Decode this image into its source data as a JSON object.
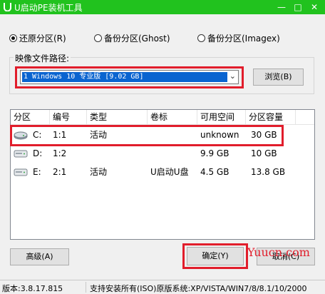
{
  "window": {
    "title": "U启动PE装机工具",
    "controls": {
      "minimize": "—",
      "maximize": "□",
      "close": "✕"
    }
  },
  "modes": [
    {
      "label": "还原分区(R)",
      "selected": true
    },
    {
      "label": "备份分区(Ghost)",
      "selected": false
    },
    {
      "label": "备份分区(Imagex)",
      "selected": false
    }
  ],
  "image_path": {
    "label": "映像文件路径:",
    "selected_value": "1 Windows 10 专业版 [9.02 GB]",
    "browse_label": "浏览(B)"
  },
  "table": {
    "headers": [
      "分区",
      "编号",
      "类型",
      "卷标",
      "可用空间",
      "分区容量"
    ],
    "rows": [
      {
        "drive": "C:",
        "number": "1:1",
        "type": "活动",
        "volume": "",
        "free": "unknown",
        "capacity": "30 GB",
        "icon": "disk-c-icon"
      },
      {
        "drive": "D:",
        "number": "1:2",
        "type": "",
        "volume": "",
        "free": "9.9 GB",
        "capacity": "10 GB",
        "icon": "disk-icon"
      },
      {
        "drive": "E:",
        "number": "2:1",
        "type": "活动",
        "volume": "U启动U盘",
        "free": "4.5 GB",
        "capacity": "13.8 GB",
        "icon": "disk-icon"
      }
    ]
  },
  "buttons": {
    "advanced": "高级(A)",
    "ok": "确定(Y)",
    "cancel": "取消(C)"
  },
  "watermark": "Yuucn.com",
  "status": {
    "version": "版本:3.8.17.815",
    "support": "支持安装所有(ISO)原版系统:XP/VISTA/WIN7/8/8.1/10/2000"
  },
  "colors": {
    "titlebar": "#21c21e",
    "highlight": "#e11d2b",
    "selection": "#0a64d0"
  }
}
